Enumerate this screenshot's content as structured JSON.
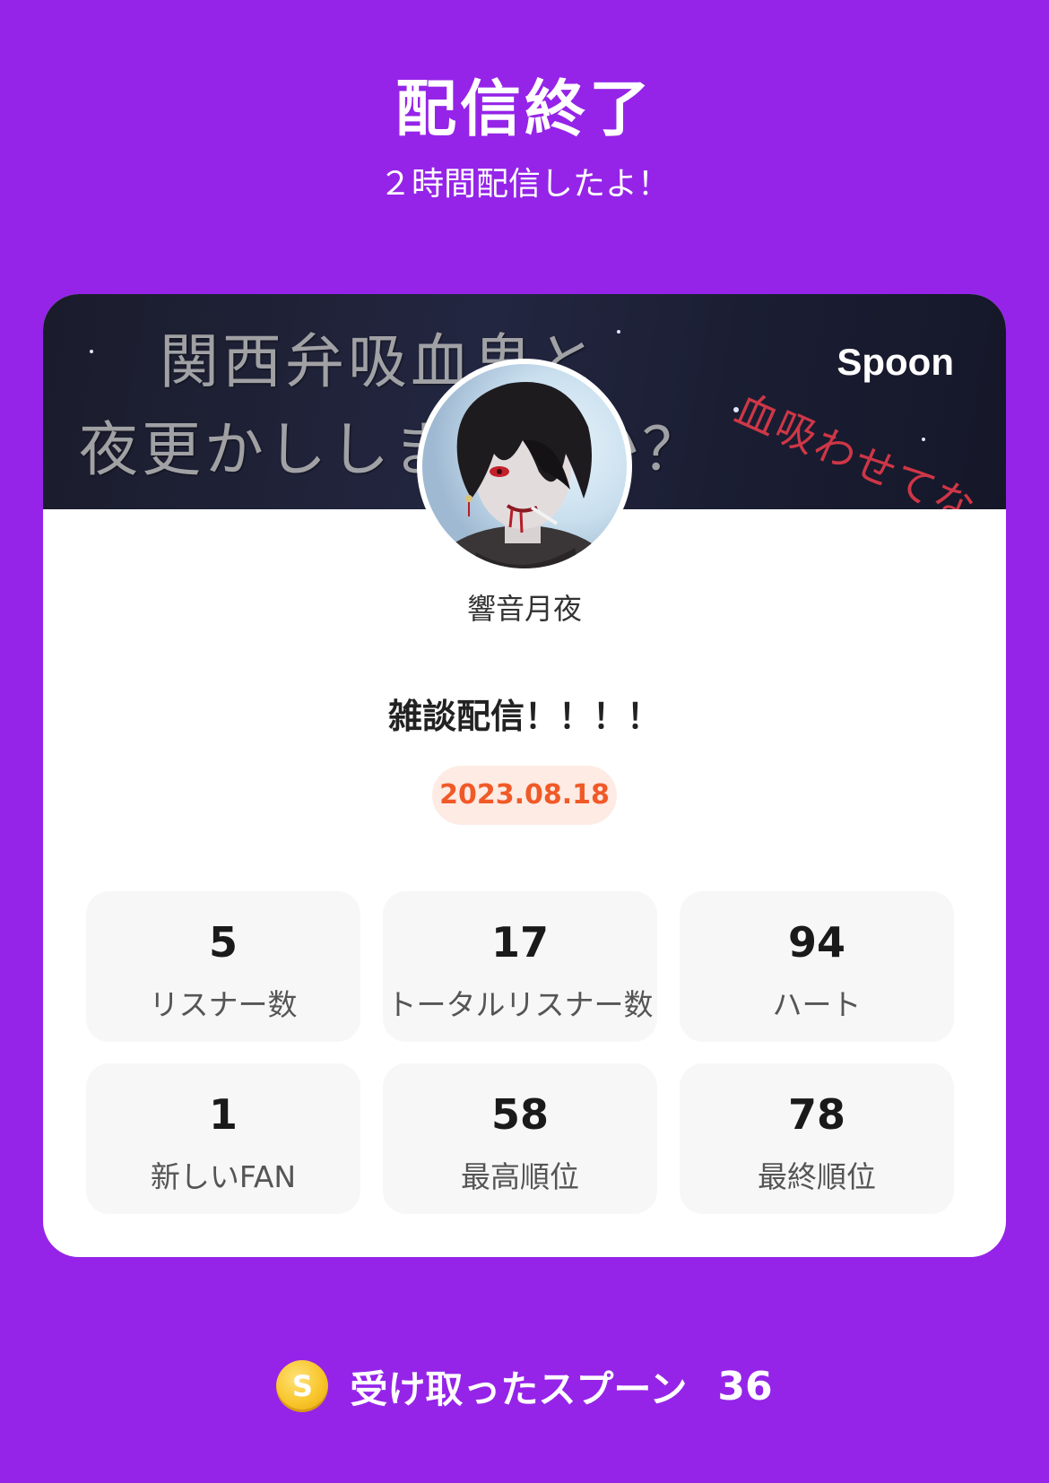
{
  "header": {
    "title": "配信終了",
    "subtitle": "２時間配信したよ！"
  },
  "card": {
    "banner": {
      "line1": "関西弁吸血鬼と",
      "line2": "夜更かししませんか？",
      "red_text": "血吸わせてな",
      "brand": "Spoon"
    },
    "username": "響音月夜",
    "stream_title": "雑談配信！！！！",
    "date": "2023.08.18",
    "stats": [
      {
        "value": "5",
        "label": "リスナー数"
      },
      {
        "value": "17",
        "label": "トータルリスナー数"
      },
      {
        "value": "94",
        "label": "ハート"
      },
      {
        "value": "1",
        "label": "新しいFAN"
      },
      {
        "value": "58",
        "label": "最高順位"
      },
      {
        "value": "78",
        "label": "最終順位"
      }
    ]
  },
  "spoons": {
    "coin_letter": "S",
    "label": "受け取ったスプーン",
    "count": "36"
  },
  "colors": {
    "background": "#9524e8",
    "date_text": "#f05a28",
    "date_badge": "#fdebe4",
    "stat_tile": "#f7f7f7"
  }
}
